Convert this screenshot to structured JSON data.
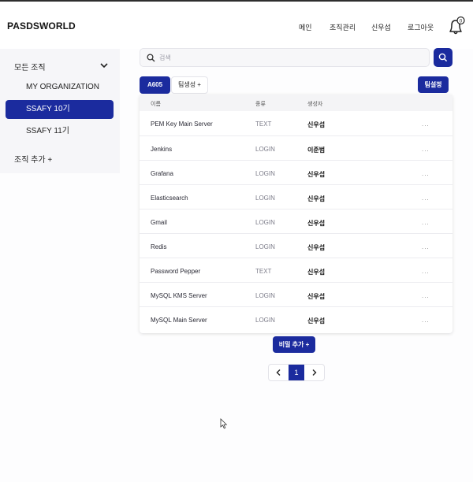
{
  "header": {
    "logo": "PASDSWORLD",
    "nav": [
      "메인",
      "조직관리",
      "신우섭",
      "로그아웃"
    ],
    "notification_count": "0"
  },
  "sidebar": {
    "heading": "모든 조직",
    "items": [
      {
        "label": "MY ORGANIZATION",
        "active": false
      },
      {
        "label": "SSAFY 10기",
        "active": true
      },
      {
        "label": "SSAFY 11기",
        "active": false
      }
    ],
    "add_label": "조직 추가 +"
  },
  "search": {
    "placeholder": "검색",
    "value": ""
  },
  "tabs": {
    "active": "A605",
    "add_label": "팀생성 +"
  },
  "team_settings_label": "팀설정",
  "table": {
    "headers": [
      "이름",
      "종류",
      "생성자"
    ],
    "rows": [
      {
        "name": "PEM Key Main Server",
        "type": "TEXT",
        "creator": "신우섭",
        "more": "..."
      },
      {
        "name": "Jenkins",
        "type": "LOGIN",
        "creator": "이준범",
        "more": "..."
      },
      {
        "name": "Grafana",
        "type": "LOGIN",
        "creator": "신우섭",
        "more": "..."
      },
      {
        "name": "Elasticsearch",
        "type": "LOGIN",
        "creator": "신우섭",
        "more": "..."
      },
      {
        "name": "Gmail",
        "type": "LOGIN",
        "creator": "신우섭",
        "more": "..."
      },
      {
        "name": "Redis",
        "type": "LOGIN",
        "creator": "신우섭",
        "more": "..."
      },
      {
        "name": "Password Pepper",
        "type": "TEXT",
        "creator": "신우섭",
        "more": "..."
      },
      {
        "name": "MySQL KMS Server",
        "type": "LOGIN",
        "creator": "신우섭",
        "more": "..."
      },
      {
        "name": "MySQL Main Server",
        "type": "LOGIN",
        "creator": "신우섭",
        "more": "..."
      }
    ]
  },
  "add_secret_label": "비밀 추가 +",
  "pagination": {
    "prev": "‹",
    "current": "1",
    "next": "›"
  },
  "colors": {
    "accent": "#1b2b9e",
    "sidebar_bg": "#f6f6f9"
  },
  "icons": [
    "bell-icon",
    "chevron-down-icon",
    "search-icon",
    "chevron-left-icon",
    "chevron-right-icon",
    "mouse-cursor-icon"
  ]
}
